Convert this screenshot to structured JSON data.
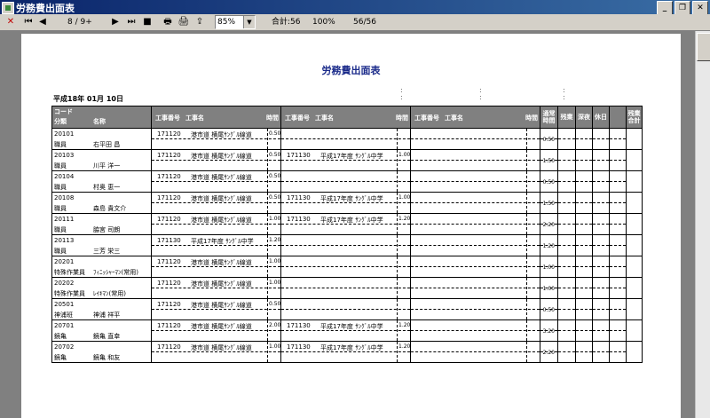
{
  "window": {
    "title": "労務費出面表"
  },
  "toolbar": {
    "page_indicator": "8 / 9+",
    "zoom": "85%",
    "summary": "合計:56",
    "percent": "100%",
    "progress": "56/56"
  },
  "report": {
    "title": "労務費出面表",
    "date": "平成18年 01月 10日",
    "headers": {
      "code": "コード",
      "category": "分類",
      "name": "名称",
      "job_no": "工事番号",
      "job_name": "工事名",
      "hours": "時間",
      "regular_hours": "通常時間",
      "overtime": "残業",
      "late_night": "深夜",
      "holiday": "休日",
      "overtime_total": "残業合計"
    },
    "rows": [
      {
        "code": "20101",
        "category": "職員",
        "name": "右平田 昌",
        "jobs": [
          {
            "no": "171120",
            "name": "港市道 横尾ｻﾝｸﾞﾙ線道",
            "hours": "0.50"
          },
          {
            "no": "",
            "name": "",
            "hours": ""
          },
          {
            "no": "",
            "name": "",
            "hours": ""
          }
        ],
        "total": "0.50"
      },
      {
        "code": "20103",
        "category": "職員",
        "name": "川平 洋一",
        "jobs": [
          {
            "no": "171120",
            "name": "港市道 横尾ｻﾝｸﾞﾙ線道",
            "hours": "0.50"
          },
          {
            "no": "171130",
            "name": "平成17年度 ｻﾝｸﾞﾙ中学",
            "hours": "1.00"
          },
          {
            "no": "",
            "name": "",
            "hours": ""
          }
        ],
        "total": "1.50"
      },
      {
        "code": "20104",
        "category": "職員",
        "name": "村奥 恵一",
        "jobs": [
          {
            "no": "171120",
            "name": "港市道 横尾ｻﾝｸﾞﾙ線道",
            "hours": "0.50"
          },
          {
            "no": "",
            "name": "",
            "hours": ""
          },
          {
            "no": "",
            "name": "",
            "hours": ""
          }
        ],
        "total": "0.50"
      },
      {
        "code": "20108",
        "category": "職員",
        "name": "森島 貴文介",
        "jobs": [
          {
            "no": "171120",
            "name": "港市道 横尾ｻﾝｸﾞﾙ線道",
            "hours": "0.50"
          },
          {
            "no": "171130",
            "name": "平成17年度 ｻﾝｸﾞﾙ中学",
            "hours": "1.00"
          },
          {
            "no": "",
            "name": "",
            "hours": ""
          }
        ],
        "total": "1.50"
      },
      {
        "code": "20111",
        "category": "職員",
        "name": "脇宮 司朗",
        "jobs": [
          {
            "no": "171120",
            "name": "港市道 横尾ｻﾝｸﾞﾙ線道",
            "hours": "1.00"
          },
          {
            "no": "171130",
            "name": "平成17年度 ｻﾝｸﾞﾙ中学",
            "hours": "1.20"
          },
          {
            "no": "",
            "name": "",
            "hours": ""
          }
        ],
        "total": "2.20"
      },
      {
        "code": "20113",
        "category": "職員",
        "name": "三芳 栄三",
        "jobs": [
          {
            "no": "171130",
            "name": "平成17年度 ｻﾝｸﾞﾙ中学",
            "hours": "1.20"
          },
          {
            "no": "",
            "name": "",
            "hours": ""
          },
          {
            "no": "",
            "name": "",
            "hours": ""
          }
        ],
        "total": "1.20"
      },
      {
        "code": "20201",
        "category": "特殊作業員",
        "name": "ﾌｨﾆｯｼｬｰﾏﾝ(常用)",
        "jobs": [
          {
            "no": "171120",
            "name": "港市道 横尾ｻﾝｸﾞﾙ線道",
            "hours": "1.00"
          },
          {
            "no": "",
            "name": "",
            "hours": ""
          },
          {
            "no": "",
            "name": "",
            "hours": ""
          }
        ],
        "total": "1.00"
      },
      {
        "code": "20202",
        "category": "特殊作業員",
        "name": "ﾚｲｷﾏﾝ(常用)",
        "jobs": [
          {
            "no": "171120",
            "name": "港市道 横尾ｻﾝｸﾞﾙ線道",
            "hours": "1.00"
          },
          {
            "no": "",
            "name": "",
            "hours": ""
          },
          {
            "no": "",
            "name": "",
            "hours": ""
          }
        ],
        "total": "1.00"
      },
      {
        "code": "20501",
        "category": "神浦班",
        "name": "神浦 祥平",
        "jobs": [
          {
            "no": "171120",
            "name": "港市道 横尾ｻﾝｸﾞﾙ線道",
            "hours": "0.50"
          },
          {
            "no": "",
            "name": "",
            "hours": ""
          },
          {
            "no": "",
            "name": "",
            "hours": ""
          }
        ],
        "total": "0.50"
      },
      {
        "code": "20701",
        "category": "鏡亀",
        "name": "鏡亀 直幸",
        "jobs": [
          {
            "no": "171120",
            "name": "港市道 横尾ｻﾝｸﾞﾙ線道",
            "hours": "2.00"
          },
          {
            "no": "171130",
            "name": "平成17年度 ｻﾝｸﾞﾙ中学",
            "hours": "1.20"
          },
          {
            "no": "",
            "name": "",
            "hours": ""
          }
        ],
        "total": "3.20"
      },
      {
        "code": "20702",
        "category": "鏡亀",
        "name": "鏡亀 和友",
        "jobs": [
          {
            "no": "171120",
            "name": "港市道 横尾ｻﾝｸﾞﾙ線道",
            "hours": "1.00"
          },
          {
            "no": "171130",
            "name": "平成17年度 ｻﾝｸﾞﾙ中学",
            "hours": "1.20"
          },
          {
            "no": "",
            "name": "",
            "hours": ""
          }
        ],
        "total": "2.20"
      }
    ]
  },
  "icons": {
    "close": "close-icon",
    "first": "first-page-icon",
    "prev": "prev-page-icon",
    "next": "next-page-icon",
    "last": "last-page-icon",
    "stop": "stop-icon",
    "print": "print-icon",
    "print_setup": "print-setup-icon",
    "export": "export-icon"
  }
}
